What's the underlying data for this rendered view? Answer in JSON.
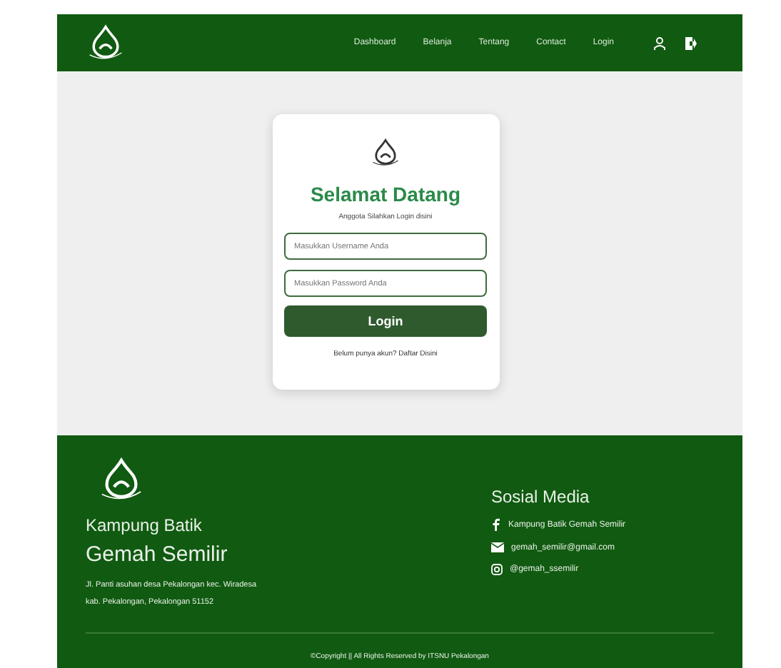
{
  "navbar": {
    "links": [
      "Dashboard",
      "Belanja",
      "Tentang",
      "Contact",
      "Login"
    ]
  },
  "login_card": {
    "title": "Selamat Datang",
    "subtitle": "Anggota Silahkan Login disini",
    "fields": [
      {
        "placeholder": "Masukkan Username Anda"
      },
      {
        "placeholder": "Masukkan Password Anda"
      }
    ],
    "button": "Login",
    "register_link": "Belum punya akun? Daftar Disini"
  },
  "footer": {
    "name_line_1": "Kampung Batik",
    "name_line_2": "Gemah Semilir",
    "address": [
      "Jl. Panti asuhan desa Pekalongan kec. Wiradesa",
      "kab. Pekalongan, Pekalongan 51152"
    ],
    "social_title": "Sosial Media",
    "social": [
      {
        "kind": "facebook",
        "text": "Kampung Batik Gemah Semilir"
      },
      {
        "kind": "email",
        "text": "gemah_semilir@gmail.com"
      },
      {
        "kind": "instagram",
        "text": "@gemah_ssemilir"
      }
    ],
    "copyright": "©Copyright || All Rights Reserved by ITSNU Pekalongan"
  }
}
